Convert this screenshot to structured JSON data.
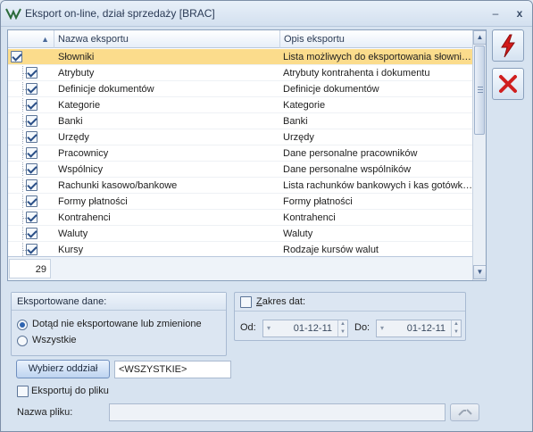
{
  "window": {
    "title": "Eksport on-line, dział sprzedaży [BRAC]",
    "minimize_glyph": "–",
    "close_glyph": "x"
  },
  "grid": {
    "sort_glyph": "▲",
    "columns": [
      "Nazwa eksportu",
      "Opis eksportu"
    ],
    "rows": [
      {
        "name": "Słowniki",
        "desc": "Lista możliwych do eksportowania słowni…",
        "checked": true,
        "selected": true
      },
      {
        "name": "Atrybuty",
        "desc": "Atrybuty kontrahenta i dokumentu",
        "checked": true
      },
      {
        "name": "Definicje dokumentów",
        "desc": "Definicje dokumentów",
        "checked": true
      },
      {
        "name": "Kategorie",
        "desc": "Kategorie",
        "checked": true
      },
      {
        "name": "Banki",
        "desc": "Banki",
        "checked": true
      },
      {
        "name": "Urzędy",
        "desc": "Urzędy",
        "checked": true
      },
      {
        "name": "Pracownicy",
        "desc": "Dane personalne pracowników",
        "checked": true
      },
      {
        "name": "Wspólnicy",
        "desc": "Dane personalne wspólników",
        "checked": true
      },
      {
        "name": "Rachunki kasowo/bankowe",
        "desc": "Lista rachunków bankowych i kas gotówk…",
        "checked": true
      },
      {
        "name": "Formy płatności",
        "desc": "Formy płatności",
        "checked": true
      },
      {
        "name": "Kontrahenci",
        "desc": "Kontrahenci",
        "checked": true
      },
      {
        "name": "Waluty",
        "desc": "Waluty",
        "checked": true
      },
      {
        "name": "Kursy",
        "desc": "Rodzaje kursów walut",
        "checked": true
      }
    ],
    "count": "29"
  },
  "side_buttons": {
    "run_icon": "lightning-icon",
    "cancel_icon": "red-x-icon"
  },
  "exported_data": {
    "title": "Eksportowane dane:",
    "options": [
      "Dotąd nie eksportowane lub zmienione",
      "Wszystkie"
    ],
    "selected_index": 0
  },
  "date_range": {
    "label_underlined": "Z",
    "label_rest": "akres dat:",
    "checked": false,
    "from_label": "Od:",
    "from_value": "01-12-11",
    "to_label": "Do:",
    "to_value": "01-12-11"
  },
  "branch": {
    "button_label": "Wybierz oddział",
    "value": "<WSZYSTKIE>"
  },
  "export_file": {
    "checkbox_label": "Eksportuj do pliku",
    "checked": false,
    "filename_label": "Nazwa pliku:",
    "filename_value": ""
  },
  "colors": {
    "selected_row": "#fbdc8c",
    "lightning_red": "#d21a1a",
    "cancel_red": "#d01f1f"
  }
}
